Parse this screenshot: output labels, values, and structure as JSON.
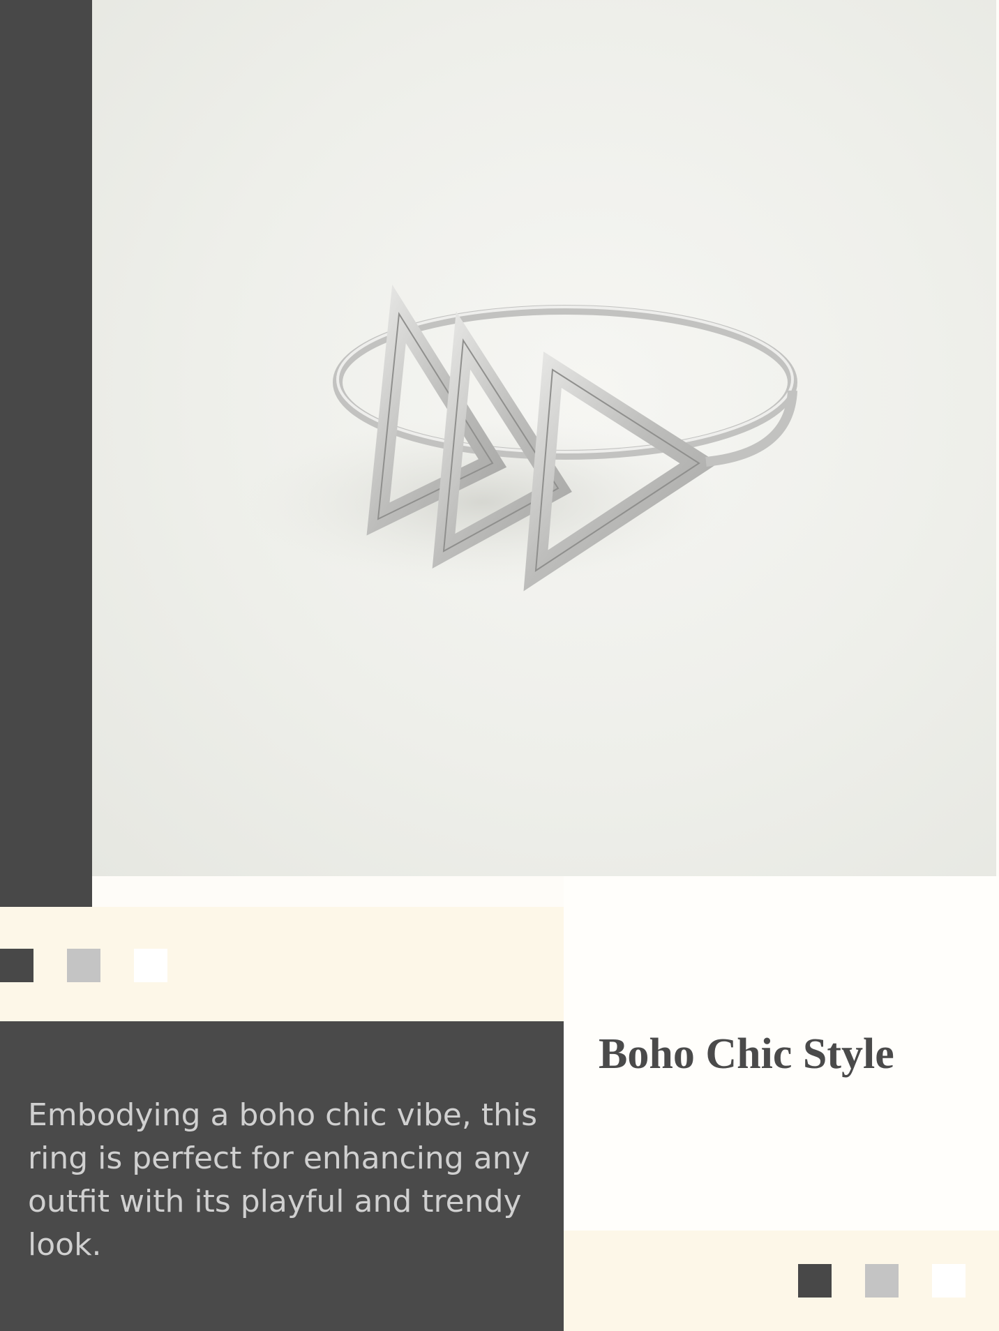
{
  "product": {
    "title": "Boho Chic Style",
    "description": "Embodying a boho chic vibe, this ring is perfect for enhancing any outfit with its playful and trendy look."
  },
  "palette": {
    "dark": "#484848",
    "gray": "#c4c4c4",
    "white": "#ffffff",
    "cream": "#fdf7e8"
  },
  "image": {
    "subject": "silver triple-triangle ring"
  }
}
